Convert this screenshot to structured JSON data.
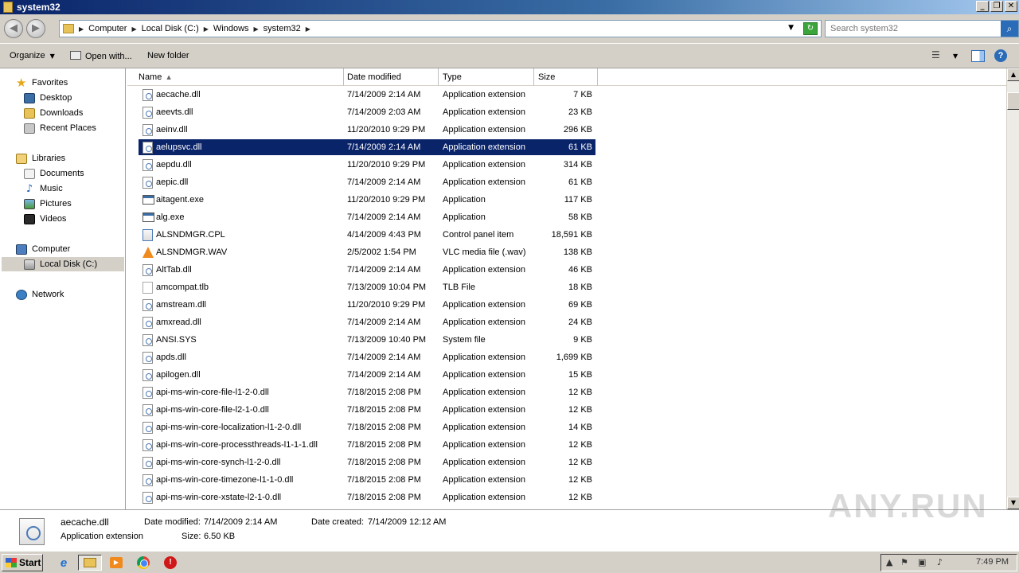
{
  "window": {
    "title": "system32"
  },
  "address": {
    "crumbs": [
      "Computer",
      "Local Disk (C:)",
      "Windows",
      "system32"
    ]
  },
  "search": {
    "placeholder": "Search system32"
  },
  "toolbar": {
    "organize_label": "Organize",
    "open_with_label": "Open with...",
    "new_folder_label": "New folder"
  },
  "nav": {
    "favorites": "Favorites",
    "desktop": "Desktop",
    "downloads": "Downloads",
    "recent_places": "Recent Places",
    "libraries": "Libraries",
    "documents": "Documents",
    "music": "Music",
    "pictures": "Pictures",
    "videos": "Videos",
    "computer": "Computer",
    "local_disk": "Local Disk (C:)",
    "network": "Network"
  },
  "columns": {
    "name": "Name",
    "date": "Date modified",
    "type": "Type",
    "size": "Size"
  },
  "files": [
    {
      "name": "aecache.dll",
      "date": "7/14/2009 2:14 AM",
      "type": "Application extension",
      "size": "7 KB",
      "icon": "dll"
    },
    {
      "name": "aeevts.dll",
      "date": "7/14/2009 2:03 AM",
      "type": "Application extension",
      "size": "23 KB",
      "icon": "dll"
    },
    {
      "name": "aeinv.dll",
      "date": "11/20/2010 9:29 PM",
      "type": "Application extension",
      "size": "296 KB",
      "icon": "dll"
    },
    {
      "name": "aelupsvc.dll",
      "date": "7/14/2009 2:14 AM",
      "type": "Application extension",
      "size": "61 KB",
      "icon": "dll",
      "selected": true
    },
    {
      "name": "aepdu.dll",
      "date": "11/20/2010 9:29 PM",
      "type": "Application extension",
      "size": "314 KB",
      "icon": "dll"
    },
    {
      "name": "aepic.dll",
      "date": "7/14/2009 2:14 AM",
      "type": "Application extension",
      "size": "61 KB",
      "icon": "dll"
    },
    {
      "name": "aitagent.exe",
      "date": "11/20/2010 9:29 PM",
      "type": "Application",
      "size": "117 KB",
      "icon": "exe"
    },
    {
      "name": "alg.exe",
      "date": "7/14/2009 2:14 AM",
      "type": "Application",
      "size": "58 KB",
      "icon": "exe"
    },
    {
      "name": "ALSNDMGR.CPL",
      "date": "4/14/2009 4:43 PM",
      "type": "Control panel item",
      "size": "18,591 KB",
      "icon": "cpl"
    },
    {
      "name": "ALSNDMGR.WAV",
      "date": "2/5/2002 1:54 PM",
      "type": "VLC media file (.wav)",
      "size": "138 KB",
      "icon": "vlc"
    },
    {
      "name": "AltTab.dll",
      "date": "7/14/2009 2:14 AM",
      "type": "Application extension",
      "size": "46 KB",
      "icon": "dll"
    },
    {
      "name": "amcompat.tlb",
      "date": "7/13/2009 10:04 PM",
      "type": "TLB File",
      "size": "18 KB",
      "icon": "blank"
    },
    {
      "name": "amstream.dll",
      "date": "11/20/2010 9:29 PM",
      "type": "Application extension",
      "size": "69 KB",
      "icon": "dll"
    },
    {
      "name": "amxread.dll",
      "date": "7/14/2009 2:14 AM",
      "type": "Application extension",
      "size": "24 KB",
      "icon": "dll"
    },
    {
      "name": "ANSI.SYS",
      "date": "7/13/2009 10:40 PM",
      "type": "System file",
      "size": "9 KB",
      "icon": "dll"
    },
    {
      "name": "apds.dll",
      "date": "7/14/2009 2:14 AM",
      "type": "Application extension",
      "size": "1,699 KB",
      "icon": "dll"
    },
    {
      "name": "apilogen.dll",
      "date": "7/14/2009 2:14 AM",
      "type": "Application extension",
      "size": "15 KB",
      "icon": "dll"
    },
    {
      "name": "api-ms-win-core-file-l1-2-0.dll",
      "date": "7/18/2015 2:08 PM",
      "type": "Application extension",
      "size": "12 KB",
      "icon": "dll"
    },
    {
      "name": "api-ms-win-core-file-l2-1-0.dll",
      "date": "7/18/2015 2:08 PM",
      "type": "Application extension",
      "size": "12 KB",
      "icon": "dll"
    },
    {
      "name": "api-ms-win-core-localization-l1-2-0.dll",
      "date": "7/18/2015 2:08 PM",
      "type": "Application extension",
      "size": "14 KB",
      "icon": "dll"
    },
    {
      "name": "api-ms-win-core-processthreads-l1-1-1.dll",
      "date": "7/18/2015 2:08 PM",
      "type": "Application extension",
      "size": "12 KB",
      "icon": "dll"
    },
    {
      "name": "api-ms-win-core-synch-l1-2-0.dll",
      "date": "7/18/2015 2:08 PM",
      "type": "Application extension",
      "size": "12 KB",
      "icon": "dll"
    },
    {
      "name": "api-ms-win-core-timezone-l1-1-0.dll",
      "date": "7/18/2015 2:08 PM",
      "type": "Application extension",
      "size": "12 KB",
      "icon": "dll"
    },
    {
      "name": "api-ms-win-core-xstate-l2-1-0.dll",
      "date": "7/18/2015 2:08 PM",
      "type": "Application extension",
      "size": "12 KB",
      "icon": "dll"
    }
  ],
  "details": {
    "name": "aecache.dll",
    "type": "Application extension",
    "modified_label": "Date modified:",
    "modified_value": "7/14/2009 2:14 AM",
    "created_label": "Date created:",
    "created_value": "7/14/2009 12:12 AM",
    "size_label": "Size:",
    "size_value": "6.50 KB"
  },
  "taskbar": {
    "start_label": "Start",
    "clock": "7:49 PM"
  },
  "watermark": "ANY.RUN",
  "colors": {
    "selection": "#0a246a",
    "chrome": "#d4d0c8"
  }
}
